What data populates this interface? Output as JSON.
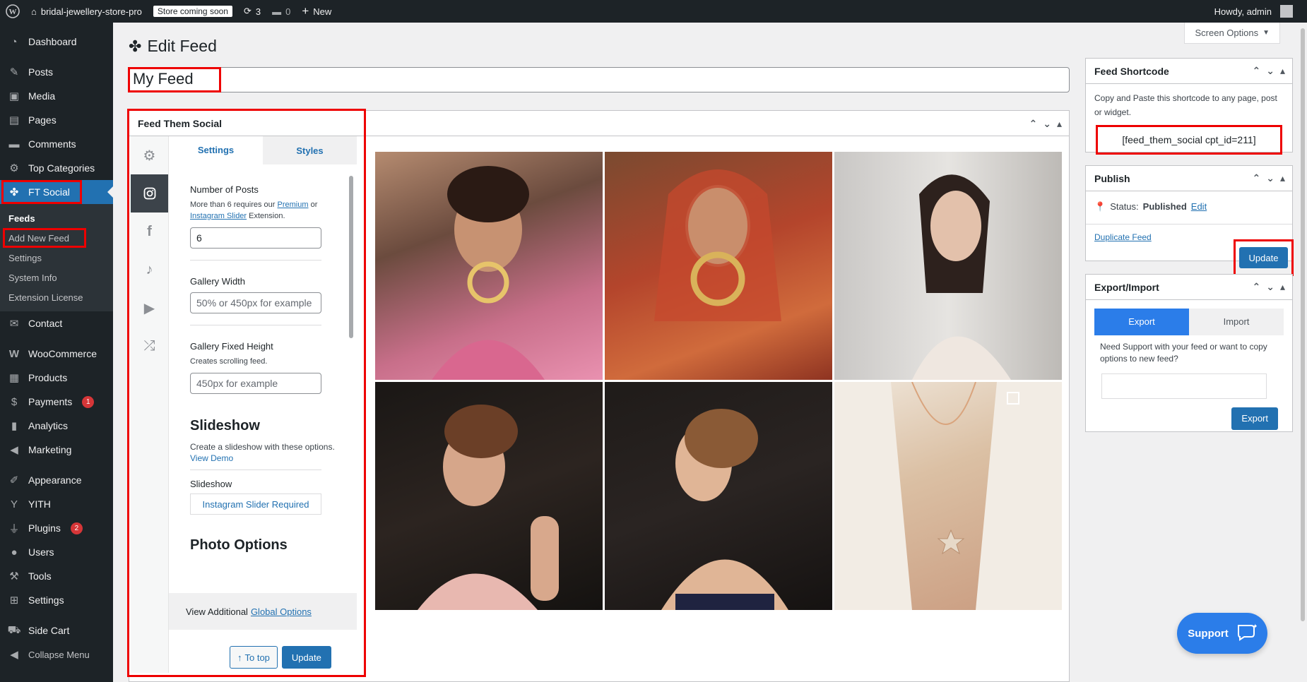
{
  "adminbar": {
    "site_name": "bridal-jewellery-store-pro",
    "badge": "Store coming soon",
    "updates": "3",
    "comments": "0",
    "new_label": "New",
    "howdy": "Howdy, admin"
  },
  "sidebar": {
    "items": [
      {
        "label": "Dashboard",
        "icon": "dashboard-icon"
      },
      {
        "label": "Posts",
        "icon": "pin-icon"
      },
      {
        "label": "Media",
        "icon": "media-icon"
      },
      {
        "label": "Pages",
        "icon": "pages-icon"
      },
      {
        "label": "Comments",
        "icon": "comment-icon"
      },
      {
        "label": "Top Categories",
        "icon": "gear-icon"
      },
      {
        "label": "FT Social",
        "icon": "ft-social-icon"
      }
    ],
    "submenu": [
      "Feeds",
      "Add New Feed",
      "Settings",
      "System Info",
      "Extension License"
    ],
    "items2": [
      {
        "label": "Contact",
        "icon": "mail-icon"
      },
      {
        "label": "WooCommerce",
        "icon": "woo-icon"
      },
      {
        "label": "Products",
        "icon": "archive-icon"
      },
      {
        "label": "Payments",
        "icon": "dollar-icon",
        "count": "1"
      },
      {
        "label": "Analytics",
        "icon": "chart-icon"
      },
      {
        "label": "Marketing",
        "icon": "megaphone-icon"
      },
      {
        "label": "Appearance",
        "icon": "brush-icon"
      },
      {
        "label": "YITH",
        "icon": "yith-icon"
      },
      {
        "label": "Plugins",
        "icon": "plugin-icon",
        "count": "2"
      },
      {
        "label": "Users",
        "icon": "user-icon"
      },
      {
        "label": "Tools",
        "icon": "wrench-icon"
      },
      {
        "label": "Settings",
        "icon": "settings-icon"
      },
      {
        "label": "Side Cart",
        "icon": "cart-icon"
      },
      {
        "label": "Collapse Menu",
        "icon": "collapse-icon"
      }
    ]
  },
  "page": {
    "screen_options": "Screen Options",
    "title": "Edit Feed",
    "feed_title": "My Feed"
  },
  "fts": {
    "box_title": "Feed Them Social",
    "tab_settings": "Settings",
    "tab_styles": "Styles",
    "num_posts_label": "Number of Posts",
    "num_posts_help_pre": "More than 6 requires our",
    "num_posts_help_premium": "Premium",
    "num_posts_help_or": "or",
    "num_posts_help_slider": "Instagram Slider",
    "num_posts_help_post": "Extension.",
    "num_posts_value": "6",
    "gallery_width_label": "Gallery Width",
    "gallery_width_placeholder": "50% or 450px for example",
    "gallery_height_label": "Gallery Fixed Height",
    "gallery_height_help": "Creates scrolling feed.",
    "gallery_height_placeholder": "450px for example",
    "slideshow_heading": "Slideshow",
    "slideshow_desc": "Create a slideshow with these options.",
    "slideshow_demo": "View Demo",
    "slideshow_label": "Slideshow",
    "slideshow_required": "Instagram Slider Required",
    "photo_options": "Photo Options",
    "global_pre": "View Additional",
    "global_link": "Global Options",
    "to_top": "To top",
    "update": "Update"
  },
  "shortcode_box": {
    "title": "Feed Shortcode",
    "desc": "Copy and Paste this shortcode to any page, post or widget.",
    "shortcode": "[feed_them_social cpt_id=211]"
  },
  "publish_box": {
    "title": "Publish",
    "status_label": "Status:",
    "status_value": "Published",
    "edit": "Edit",
    "duplicate": "Duplicate Feed",
    "update": "Update"
  },
  "export_box": {
    "title": "Export/Import",
    "tab_export": "Export",
    "tab_import": "Import",
    "desc": "Need Support with your feed or want to copy options to new feed?",
    "export_btn": "Export"
  },
  "support": "Support"
}
